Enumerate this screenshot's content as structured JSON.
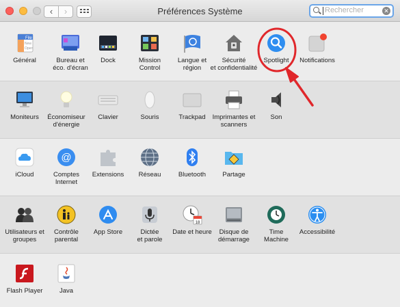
{
  "window": {
    "title": "Préférences Système",
    "search_placeholder": "Rechercher"
  },
  "rows": [
    {
      "items": [
        {
          "id": "general",
          "label": "Général",
          "icon": "general-icon"
        },
        {
          "id": "desktop",
          "label": "Bureau et\néco. d'écran",
          "icon": "desktop-screensaver-icon"
        },
        {
          "id": "dock",
          "label": "Dock",
          "icon": "dock-icon"
        },
        {
          "id": "mission-control",
          "label": "Mission\nControl",
          "icon": "mission-control-icon"
        },
        {
          "id": "language",
          "label": "Langue et\nrégion",
          "icon": "language-flag-icon"
        },
        {
          "id": "security",
          "label": "Sécurité\net confidentialité",
          "icon": "security-house-icon"
        },
        {
          "id": "spotlight",
          "label": "Spotlight",
          "icon": "spotlight-icon"
        },
        {
          "id": "notifications",
          "label": "Notifications",
          "icon": "notifications-icon"
        }
      ]
    },
    {
      "items": [
        {
          "id": "displays",
          "label": "Moniteurs",
          "icon": "display-icon"
        },
        {
          "id": "energy",
          "label": "Économiseur\nd'énergie",
          "icon": "lightbulb-icon"
        },
        {
          "id": "keyboard",
          "label": "Clavier",
          "icon": "keyboard-icon"
        },
        {
          "id": "mouse",
          "label": "Souris",
          "icon": "mouse-icon"
        },
        {
          "id": "trackpad",
          "label": "Trackpad",
          "icon": "trackpad-icon"
        },
        {
          "id": "printers",
          "label": "Imprimantes et\nscanners",
          "icon": "printer-icon"
        },
        {
          "id": "sound",
          "label": "Son",
          "icon": "speaker-icon"
        }
      ]
    },
    {
      "items": [
        {
          "id": "icloud",
          "label": "iCloud",
          "icon": "icloud-icon"
        },
        {
          "id": "internet-accounts",
          "label": "Comptes\nInternet",
          "icon": "internet-accounts-at-icon"
        },
        {
          "id": "extensions",
          "label": "Extensions",
          "icon": "puzzle-icon"
        },
        {
          "id": "network",
          "label": "Réseau",
          "icon": "network-globe-icon"
        },
        {
          "id": "bluetooth",
          "label": "Bluetooth",
          "icon": "bluetooth-icon"
        },
        {
          "id": "sharing",
          "label": "Partage",
          "icon": "sharing-folder-icon"
        }
      ]
    },
    {
      "items": [
        {
          "id": "users",
          "label": "Utilisateurs et\ngroupes",
          "icon": "users-icon"
        },
        {
          "id": "parental",
          "label": "Contrôle\nparental",
          "icon": "parental-controls-icon"
        },
        {
          "id": "app-store",
          "label": "App Store",
          "icon": "app-store-icon"
        },
        {
          "id": "dictation",
          "label": "Dictée\net parole",
          "icon": "microphone-icon"
        },
        {
          "id": "date-time",
          "label": "Date et heure",
          "icon": "clock-calendar-icon"
        },
        {
          "id": "startup-disk",
          "label": "Disque de\ndémarrage",
          "icon": "startup-disk-icon"
        },
        {
          "id": "time-machine",
          "label": "Time\nMachine",
          "icon": "time-machine-icon"
        },
        {
          "id": "accessibility",
          "label": "Accessibilité",
          "icon": "accessibility-icon"
        }
      ]
    },
    {
      "items": [
        {
          "id": "flash",
          "label": "Flash Player",
          "icon": "flash-player-icon"
        },
        {
          "id": "java",
          "label": "Java",
          "icon": "java-icon"
        }
      ]
    }
  ],
  "highlight": {
    "target": "Spotlight",
    "color": "#e0272b"
  }
}
